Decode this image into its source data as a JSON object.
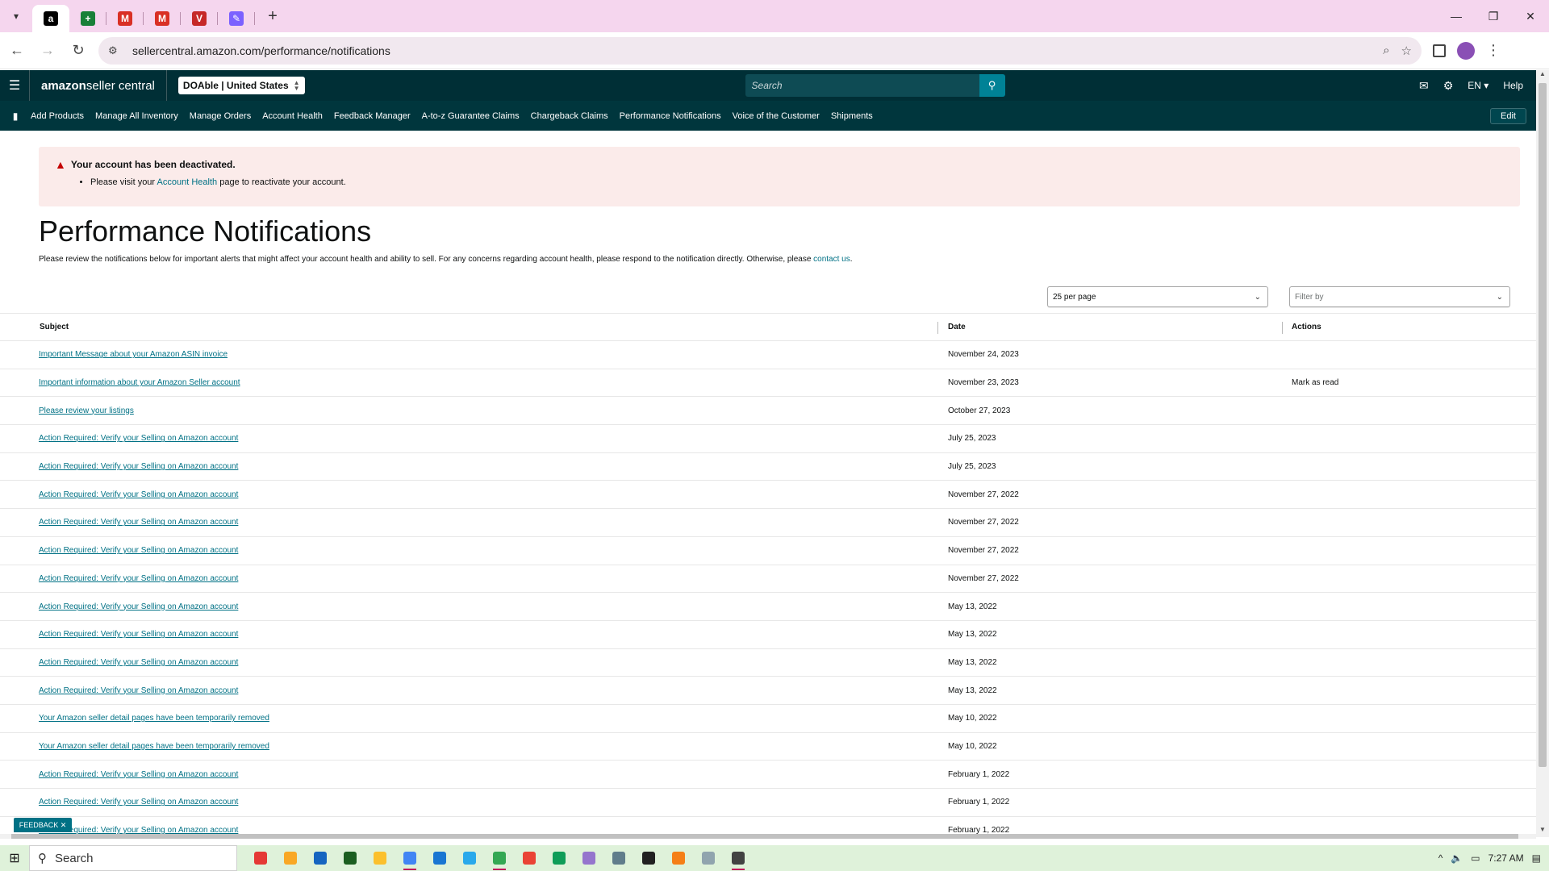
{
  "browser": {
    "tabs": [
      {
        "name": "amazon",
        "glyph": "a",
        "color": "#000000"
      },
      {
        "name": "sheets",
        "glyph": "+",
        "color": "#188038"
      },
      {
        "name": "gmail-1",
        "glyph": "M",
        "color": "#d93025"
      },
      {
        "name": "gmail-2",
        "glyph": "M",
        "color": "#d93025"
      },
      {
        "name": "tab-v",
        "glyph": "V",
        "color": "#c62828"
      },
      {
        "name": "tab-edit",
        "glyph": "✎",
        "color": "#7b61ff"
      }
    ],
    "url": "sellercentral.amazon.com/performance/notifications"
  },
  "header": {
    "logo_bold": "amazon",
    "logo_rest": " seller central",
    "account": "DOAble | United States",
    "search_placeholder": "Search",
    "lang": "EN",
    "help": "Help"
  },
  "nav": {
    "items": [
      "Add Products",
      "Manage All Inventory",
      "Manage Orders",
      "Account Health",
      "Feedback Manager",
      "A-to-z Guarantee Claims",
      "Chargeback Claims",
      "Performance Notifications",
      "Voice of the Customer",
      "Shipments"
    ],
    "edit": "Edit"
  },
  "alert": {
    "title": "Your account has been deactivated.",
    "pre": "Please visit your ",
    "link": "Account Health",
    "post": " page to reactivate your account."
  },
  "page": {
    "title": "Performance Notifications",
    "desc_pre": "Please review the notifications below for important alerts that might affect your account health and ability to sell. For any concerns regarding account health, please respond to the notification directly. Otherwise, please ",
    "desc_link": "contact us",
    "desc_post": ".",
    "per_page": "25 per page",
    "filter_placeholder": "Filter by"
  },
  "table": {
    "headers": {
      "subject": "Subject",
      "date": "Date",
      "actions": "Actions"
    },
    "rows": [
      {
        "subject": "Important Message about your Amazon ASIN invoice",
        "date": "November 24, 2023",
        "action": ""
      },
      {
        "subject": "Important information about your Amazon Seller account",
        "date": "November 23, 2023",
        "action": "Mark as read"
      },
      {
        "subject": "Please review your listings",
        "date": "October 27, 2023",
        "action": ""
      },
      {
        "subject": "Action Required: Verify your Selling on Amazon account",
        "date": "July 25, 2023",
        "action": ""
      },
      {
        "subject": "Action Required: Verify your Selling on Amazon account",
        "date": "July 25, 2023",
        "action": ""
      },
      {
        "subject": "Action Required: Verify your Selling on Amazon account",
        "date": "November 27, 2022",
        "action": ""
      },
      {
        "subject": "Action Required: Verify your Selling on Amazon account",
        "date": "November 27, 2022",
        "action": ""
      },
      {
        "subject": "Action Required: Verify your Selling on Amazon account",
        "date": "November 27, 2022",
        "action": ""
      },
      {
        "subject": "Action Required: Verify your Selling on Amazon account",
        "date": "November 27, 2022",
        "action": ""
      },
      {
        "subject": "Action Required: Verify your Selling on Amazon account",
        "date": "May 13, 2022",
        "action": ""
      },
      {
        "subject": "Action Required: Verify your Selling on Amazon account",
        "date": "May 13, 2022",
        "action": ""
      },
      {
        "subject": "Action Required: Verify your Selling on Amazon account",
        "date": "May 13, 2022",
        "action": ""
      },
      {
        "subject": "Action Required: Verify your Selling on Amazon account",
        "date": "May 13, 2022",
        "action": ""
      },
      {
        "subject": "Your Amazon seller detail pages have been temporarily removed",
        "date": "May 10, 2022",
        "action": ""
      },
      {
        "subject": "Your Amazon seller detail pages have been temporarily removed",
        "date": "May 10, 2022",
        "action": ""
      },
      {
        "subject": "Action Required: Verify your Selling on Amazon account",
        "date": "February 1, 2022",
        "action": ""
      },
      {
        "subject": "Action Required: Verify your Selling on Amazon account",
        "date": "February 1, 2022",
        "action": ""
      },
      {
        "subject": "Action Required: Verify your Selling on Amazon account",
        "date": "February 1, 2022",
        "action": ""
      }
    ]
  },
  "feedback": "FEEDBACK",
  "taskbar": {
    "search": "Search",
    "time": "7:27 AM",
    "apps": [
      "#e53935",
      "#f9a825",
      "#1565c0",
      "#1b5e20",
      "#fbc02d",
      "#4285f4",
      "#1976d2",
      "#29a9eb",
      "#34a853",
      "#ea4335",
      "#0f9d58",
      "#9575cd",
      "#607d8b",
      "#212121",
      "#f57f17",
      "#90a4ae",
      "#424242"
    ]
  }
}
